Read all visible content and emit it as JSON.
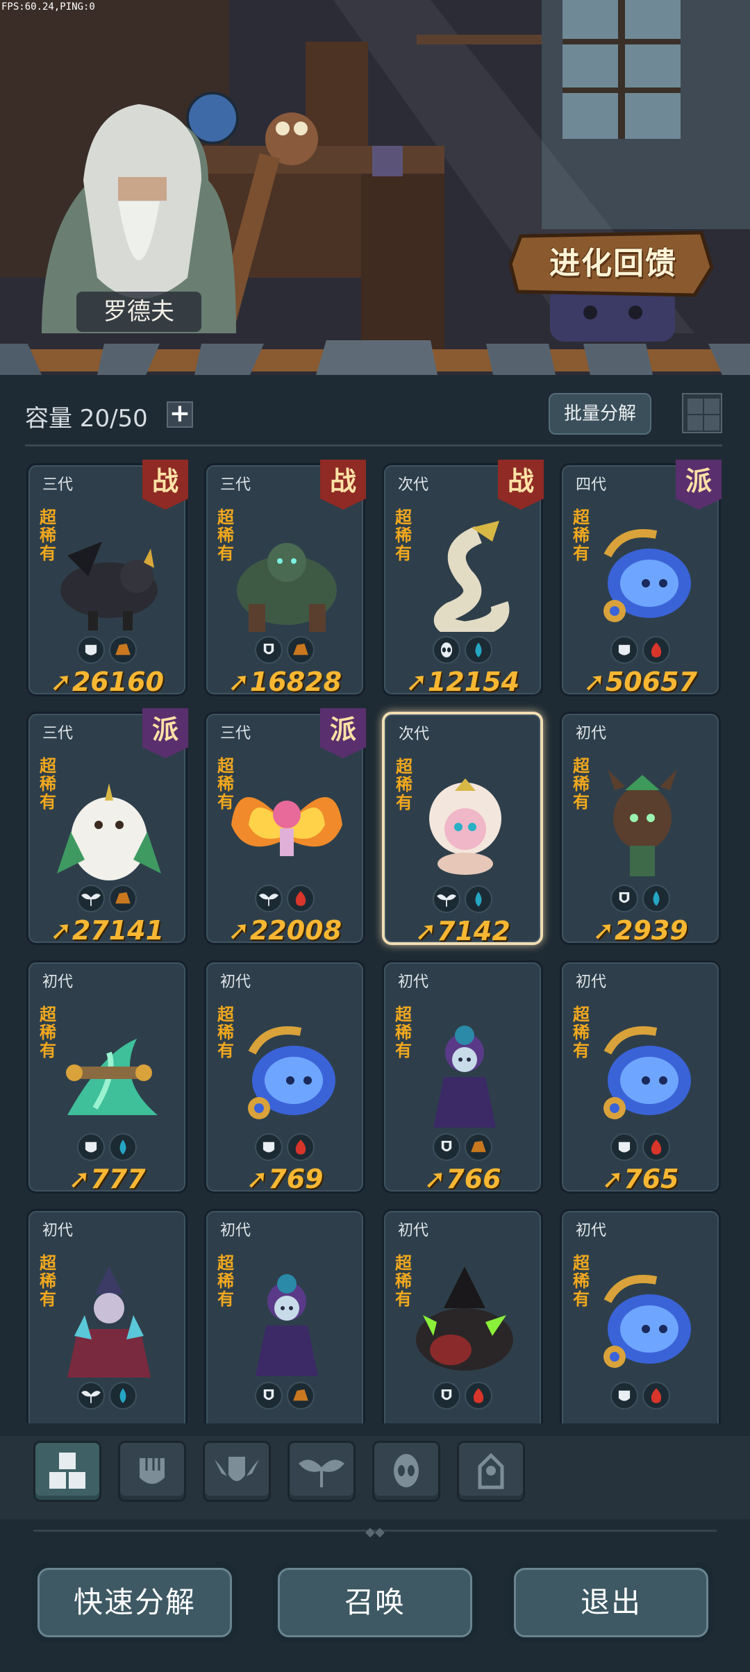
{
  "hud": {
    "fps_text": "FPS:60.24,PING:0"
  },
  "scene": {
    "npc_name": "罗德夫",
    "evolution_button": "进化回馈"
  },
  "inventory": {
    "capacity_label": "容量 20/50",
    "plus_symbol": "+",
    "batch_decompose": "批量分解"
  },
  "cards": [
    {
      "gen": "三代",
      "rarity": "超稀有",
      "badge": "战",
      "badge_type": "zhan",
      "icons": [
        "fist-icon",
        "earth-icon"
      ],
      "power": "26160",
      "creature": "black-wolf"
    },
    {
      "gen": "三代",
      "rarity": "超稀有",
      "badge": "战",
      "badge_type": "zhan",
      "icons": [
        "shield-icon",
        "earth-icon"
      ],
      "power": "16828",
      "creature": "forest-golem"
    },
    {
      "gen": "次代",
      "rarity": "超稀有",
      "badge": "战",
      "badge_type": "zhan",
      "icons": [
        "alien-icon",
        "water-icon"
      ],
      "power": "12154",
      "creature": "serpent"
    },
    {
      "gen": "四代",
      "rarity": "超稀有",
      "badge": "派",
      "badge_type": "pai",
      "icons": [
        "fist-icon",
        "fire-icon"
      ],
      "power": "50657",
      "creature": "blue-spirit"
    },
    {
      "gen": "三代",
      "rarity": "超稀有",
      "badge": "派",
      "badge_type": "pai",
      "icons": [
        "leaf-icon",
        "earth-icon"
      ],
      "power": "27141",
      "creature": "white-owl"
    },
    {
      "gen": "三代",
      "rarity": "超稀有",
      "badge": "派",
      "badge_type": "pai",
      "icons": [
        "leaf-icon",
        "fire-icon"
      ],
      "power": "22008",
      "creature": "fire-fairy"
    },
    {
      "gen": "次代",
      "rarity": "超稀有",
      "badge": "",
      "badge_type": "",
      "icons": [
        "leaf-icon",
        "water-icon"
      ],
      "power": "7142",
      "creature": "pink-sheep",
      "selected": true
    },
    {
      "gen": "初代",
      "rarity": "超稀有",
      "badge": "",
      "badge_type": "",
      "icons": [
        "shield-icon",
        "water-icon"
      ],
      "power": "2939",
      "creature": "tree-sprite"
    },
    {
      "gen": "初代",
      "rarity": "超稀有",
      "badge": "",
      "badge_type": "",
      "icons": [
        "fist-icon",
        "water-icon"
      ],
      "power": "777",
      "creature": "water-dragon"
    },
    {
      "gen": "初代",
      "rarity": "超稀有",
      "badge": "",
      "badge_type": "",
      "icons": [
        "fist-icon",
        "fire-icon"
      ],
      "power": "769",
      "creature": "blue-spirit"
    },
    {
      "gen": "初代",
      "rarity": "超稀有",
      "badge": "",
      "badge_type": "",
      "icons": [
        "shield-icon",
        "earth-icon"
      ],
      "power": "766",
      "creature": "rose-girl"
    },
    {
      "gen": "初代",
      "rarity": "超稀有",
      "badge": "",
      "badge_type": "",
      "icons": [
        "fist-icon",
        "fire-icon"
      ],
      "power": "765",
      "creature": "blue-spirit"
    },
    {
      "gen": "初代",
      "rarity": "超稀有",
      "badge": "",
      "badge_type": "",
      "icons": [
        "leaf-icon",
        "water-icon"
      ],
      "power": "",
      "creature": "crystal-witch"
    },
    {
      "gen": "初代",
      "rarity": "超稀有",
      "badge": "",
      "badge_type": "",
      "icons": [
        "shield-icon",
        "earth-icon"
      ],
      "power": "",
      "creature": "rose-girl"
    },
    {
      "gen": "初代",
      "rarity": "超稀有",
      "badge": "",
      "badge_type": "",
      "icons": [
        "shield-icon",
        "fire-icon"
      ],
      "power": "",
      "creature": "dark-beast"
    },
    {
      "gen": "初代",
      "rarity": "超稀有",
      "badge": "",
      "badge_type": "",
      "icons": [
        "fist-icon",
        "fire-icon"
      ],
      "power": "",
      "creature": "blue-spirit"
    }
  ],
  "tabs": [
    {
      "name": "tab-all",
      "icon": "blocks-icon",
      "active": true
    },
    {
      "name": "tab-fighter",
      "icon": "fist-icon"
    },
    {
      "name": "tab-defender",
      "icon": "winged-shield-icon"
    },
    {
      "name": "tab-support",
      "icon": "leaf-icon"
    },
    {
      "name": "tab-special",
      "icon": "alien-icon"
    },
    {
      "name": "tab-tower",
      "icon": "tower-icon"
    }
  ],
  "buttons": {
    "quick_decompose": "快速分解",
    "summon": "召唤",
    "exit": "退出"
  },
  "colors": {
    "power": "#f7b733",
    "rarity": "#f2a81e",
    "badge_battle": "#8f2a24",
    "badge_faction": "#5a2f6e"
  }
}
